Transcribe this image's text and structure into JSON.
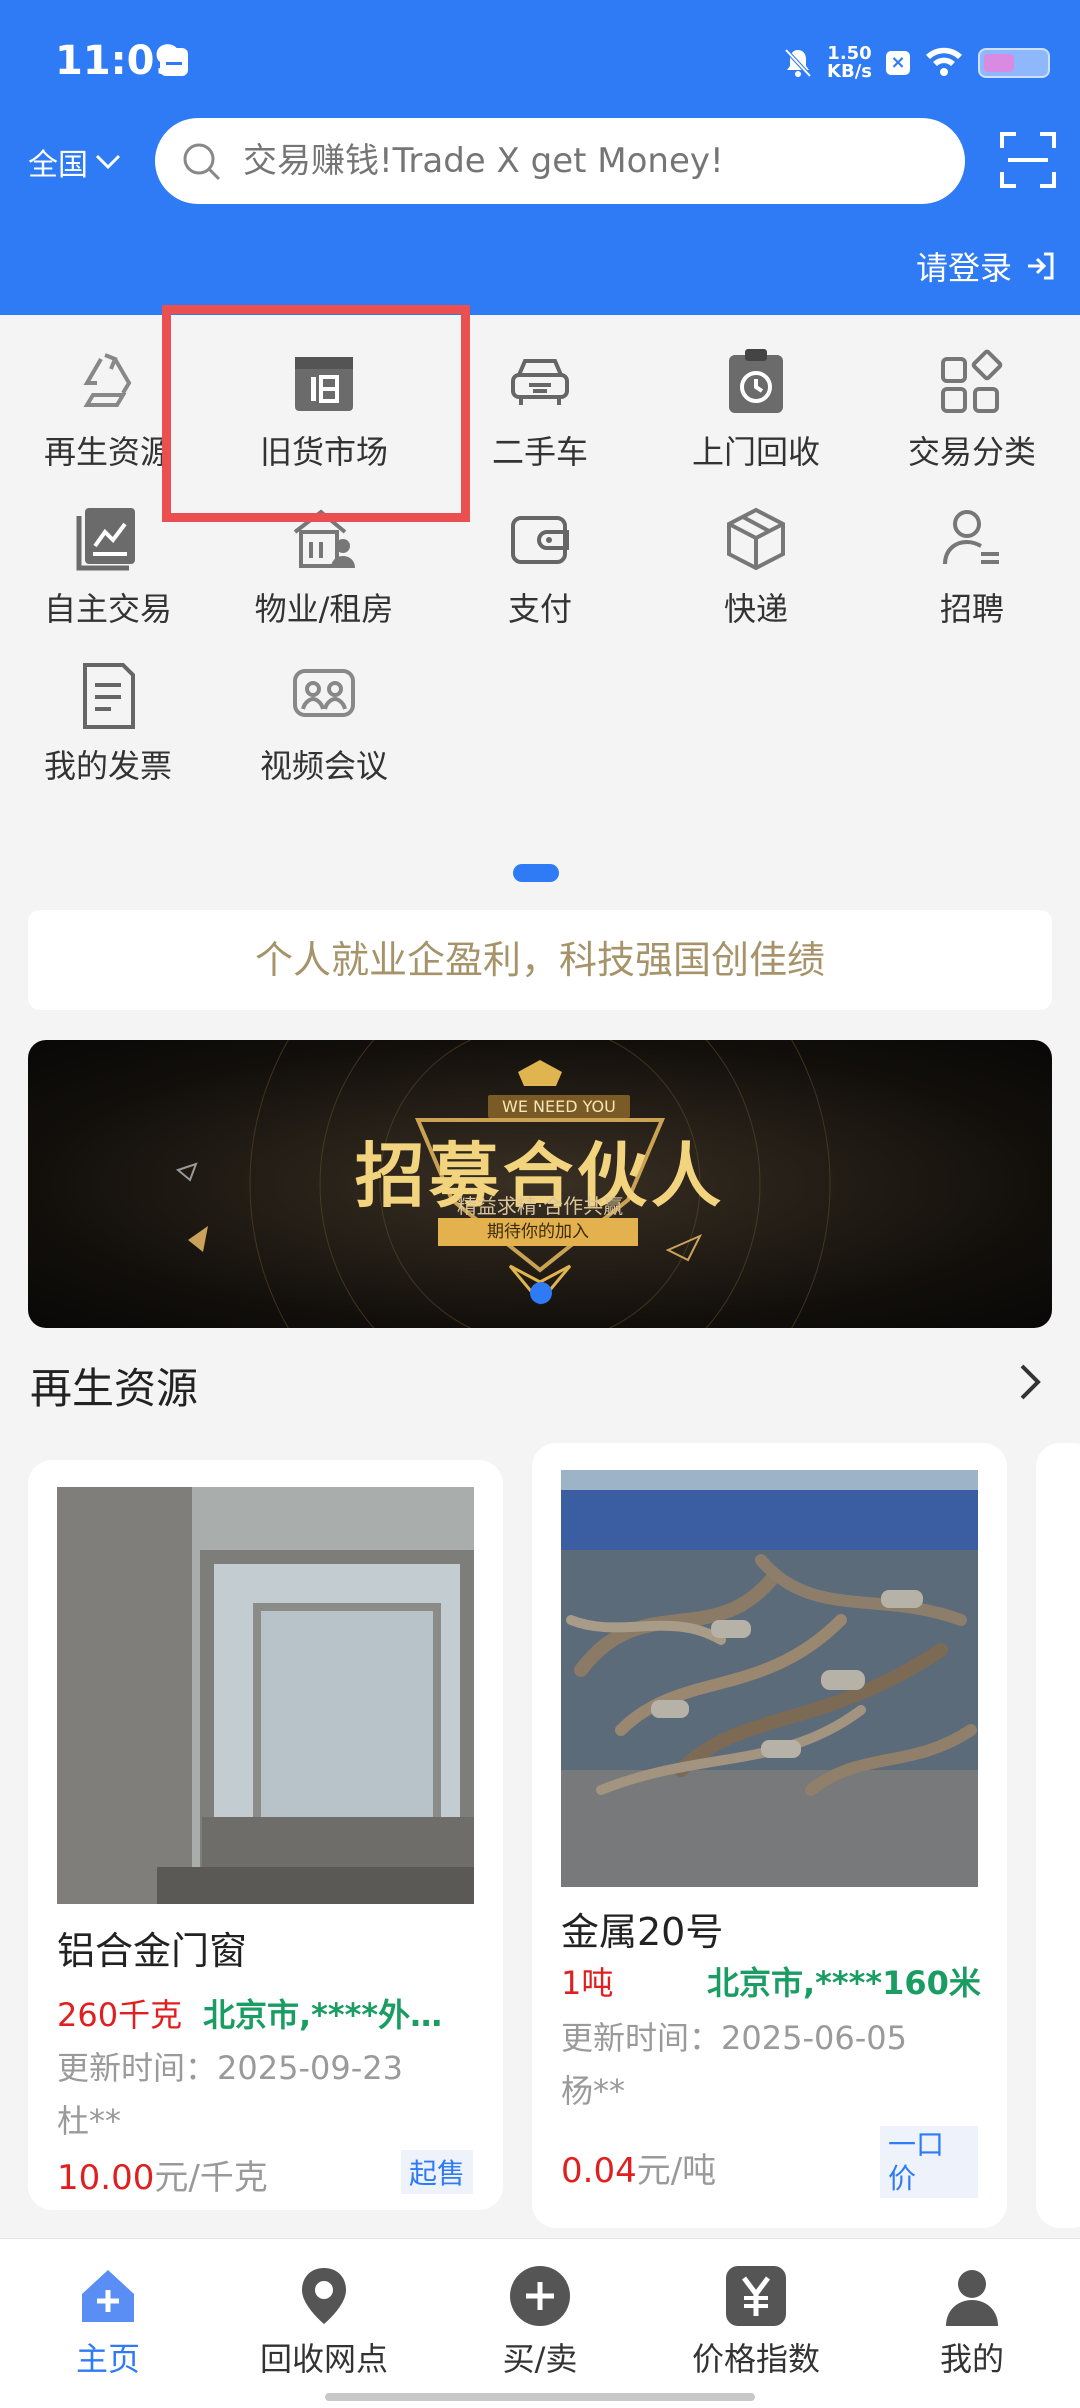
{
  "status_bar": {
    "time": "11:09",
    "net_speed_value": "1.50",
    "net_speed_unit": "KB/s"
  },
  "header": {
    "region": "全国",
    "search_placeholder": "交易赚钱!Trade X get Money!",
    "login": "请登录"
  },
  "grid": [
    {
      "label": "再生资源",
      "icon": "recycle-icon"
    },
    {
      "label": "旧货市场",
      "icon": "box-icon"
    },
    {
      "label": "二手车",
      "icon": "car-icon"
    },
    {
      "label": "上门回收",
      "icon": "clipboard-clock-icon"
    },
    {
      "label": "交易分类",
      "icon": "category-icon"
    },
    {
      "label": "自主交易",
      "icon": "book-chart-icon"
    },
    {
      "label": "物业/租房",
      "icon": "building-person-icon"
    },
    {
      "label": "支付",
      "icon": "wallet-icon"
    },
    {
      "label": "快递",
      "icon": "package-icon"
    },
    {
      "label": "招聘",
      "icon": "person-list-icon"
    },
    {
      "label": "我的发票",
      "icon": "invoice-icon"
    },
    {
      "label": "视频会议",
      "icon": "meeting-icon"
    }
  ],
  "slogan": "个人就业企盈利，科技强国创佳绩",
  "banner": {
    "tag": "WE NEED YOU",
    "title": "招募合伙人",
    "subtitle": "精益求精·合作共赢",
    "pill": "期待你的加入"
  },
  "section": {
    "title": "再生资源"
  },
  "products": [
    {
      "name": "铝合金门窗",
      "qty": "260千克",
      "location": "北京市,****外…",
      "updated": "更新时间：2025-09-23",
      "seller": "杜**",
      "price_value": "10.00",
      "price_unit": "元/千克",
      "badge": "起售"
    },
    {
      "name": "金属20号",
      "qty": "1吨",
      "location": "北京市,****160米",
      "updated": "更新时间：2025-06-05",
      "seller": "杨**",
      "price_value": "0.04",
      "price_unit": "元/吨",
      "badge": "一口价"
    }
  ],
  "bottom_nav": [
    {
      "label": "主页",
      "icon": "home-icon",
      "active": true
    },
    {
      "label": "回收网点",
      "icon": "location-pin-icon"
    },
    {
      "label": "买/卖",
      "icon": "plus-circle-icon"
    },
    {
      "label": "价格指数",
      "icon": "yen-icon"
    },
    {
      "label": "我的",
      "icon": "person-icon"
    }
  ],
  "colors": {
    "brand": "#2f7af5",
    "price_red": "#e02020",
    "location_green": "#1a9d62",
    "slogan_gold": "#a7936a",
    "highlight": "#ea5050"
  }
}
